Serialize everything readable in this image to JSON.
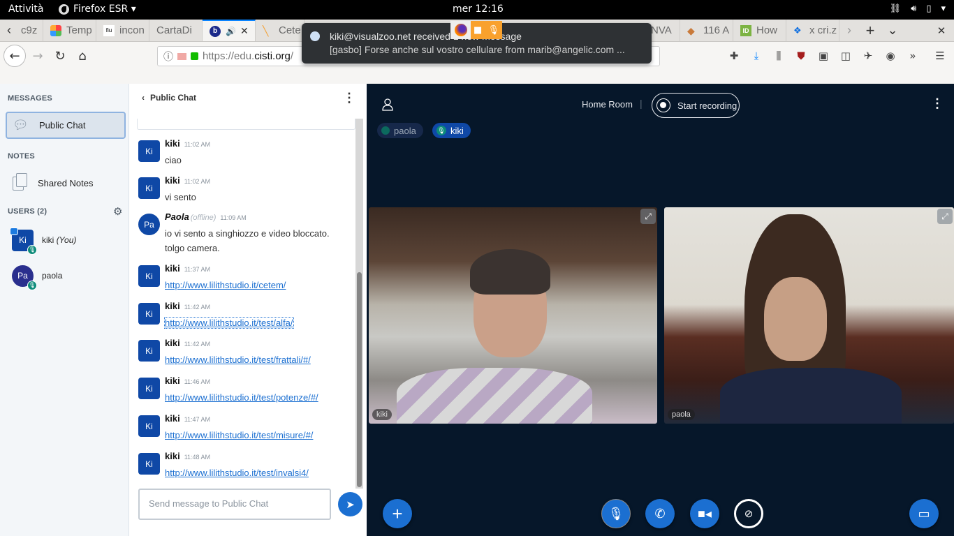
{
  "system_bar": {
    "activities": "Attività",
    "app_name": "Firefox ESR ▾",
    "clock": "mer 12:16",
    "tray_icons": [
      "network-icon",
      "volume-icon",
      "battery-icon",
      "chevron-down-icon"
    ]
  },
  "tabs": [
    {
      "label": "c9z",
      "icon": "blank",
      "active": false
    },
    {
      "label": "Temp",
      "icon": "joomla-icon",
      "active": false
    },
    {
      "label": "incon",
      "icon": "fiu-icon",
      "active": false
    },
    {
      "label": "CartaDi",
      "icon": "none",
      "active": false
    },
    {
      "label": "",
      "icon": "bigbluebutton-icon",
      "active": true,
      "audio": "🔊",
      "close": "✕"
    },
    {
      "label": "Cete",
      "icon": "pen-icon",
      "active": false
    },
    {
      "label": "NVA",
      "icon": "none",
      "active": false
    },
    {
      "label": "116 A",
      "icon": "tag-icon",
      "active": false
    },
    {
      "label": "How",
      "icon": "id-icon",
      "active": false
    },
    {
      "label": "x cri.z",
      "icon": "dropbox-icon",
      "active": false
    }
  ],
  "tab_controls": {
    "scroll_left": "‹",
    "scroll_right": "›",
    "new_tab": "+",
    "list_all": "⌄",
    "close_window": "✕"
  },
  "navbar": {
    "back": "←",
    "forward": "→",
    "reload": "↻",
    "home": "⌂",
    "url_prefix": "https://edu.",
    "url_host": "cisti.org",
    "url_suffix": "/"
  },
  "toolbar_icons": [
    "extensions-icon",
    "download-icon",
    "library-icon",
    "ublock-icon",
    "s-extension-icon",
    "sidebar-icon",
    "dog-extension-icon",
    "account-icon",
    "overflow-icon",
    "menu-icon"
  ],
  "notification": {
    "title": "kiki@visualzoo.net received 1 new message",
    "body": "[gasbo] Forse anche sul vostro cellulare from marib@angelic.com ..."
  },
  "sidebar": {
    "messages_title": "MESSAGES",
    "public_chat": "Public Chat",
    "notes_title": "NOTES",
    "shared_notes": "Shared Notes",
    "users_title": "USERS (2)",
    "users": [
      {
        "initials": "Ki",
        "name": "kiki",
        "suffix": "(You)",
        "presenter": true
      },
      {
        "initials": "Pa",
        "name": "paola",
        "suffix": "",
        "presenter": false
      }
    ]
  },
  "chat": {
    "title": "Public Chat",
    "input_placeholder": "Send message to Public Chat",
    "messages": [
      {
        "initials": "Ki",
        "author": "kiki",
        "time": "11:02 AM",
        "lines": [
          "ciao"
        ]
      },
      {
        "initials": "Ki",
        "author": "kiki",
        "time": "11:02 AM",
        "lines": [
          "vi sento"
        ]
      },
      {
        "initials": "Pa",
        "author": "Paola",
        "status": "(offline)",
        "time": "11:09 AM",
        "lines": [
          "io vi sento a singhiozzo e video bloccato.",
          "tolgo camera."
        ]
      },
      {
        "initials": "Ki",
        "author": "kiki",
        "time": "11:37 AM",
        "link": "http://www.lilithstudio.it/cetem/"
      },
      {
        "initials": "Ki",
        "author": "kiki",
        "time": "11:42 AM",
        "link": "http://www.lilithstudio.it/test/alfa/"
      },
      {
        "initials": "Ki",
        "author": "kiki",
        "time": "11:42 AM",
        "link": "http://www.lilithstudio.it/test/frattali/#/"
      },
      {
        "initials": "Ki",
        "author": "kiki",
        "time": "11:46 AM",
        "link": "http://www.lilithstudio.it/test/potenze/#/"
      },
      {
        "initials": "Ki",
        "author": "kiki",
        "time": "11:47 AM",
        "link": "http://www.lilithstudio.it/test/misure/#/"
      },
      {
        "initials": "Ki",
        "author": "kiki",
        "time": "11:48 AM",
        "link": "http://www.lilithstudio.it/test/invalsi4/"
      }
    ]
  },
  "main": {
    "room_name": "Home Room",
    "record_label": "Start recording",
    "talkers": [
      {
        "name": "paola",
        "talking": false
      },
      {
        "name": "kiki",
        "talking": true
      }
    ],
    "videos": [
      {
        "name": "kiki"
      },
      {
        "name": "paola"
      }
    ],
    "actions": [
      "plus-icon",
      "microphone-icon",
      "phone-icon",
      "camera-icon",
      "screenshare-off-icon",
      "presentation-icon"
    ]
  },
  "colors": {
    "accent": "#1b6fd1",
    "dark_bg": "#06172a",
    "avatar": "#0f48a6",
    "talking": "#0c8b7a"
  }
}
